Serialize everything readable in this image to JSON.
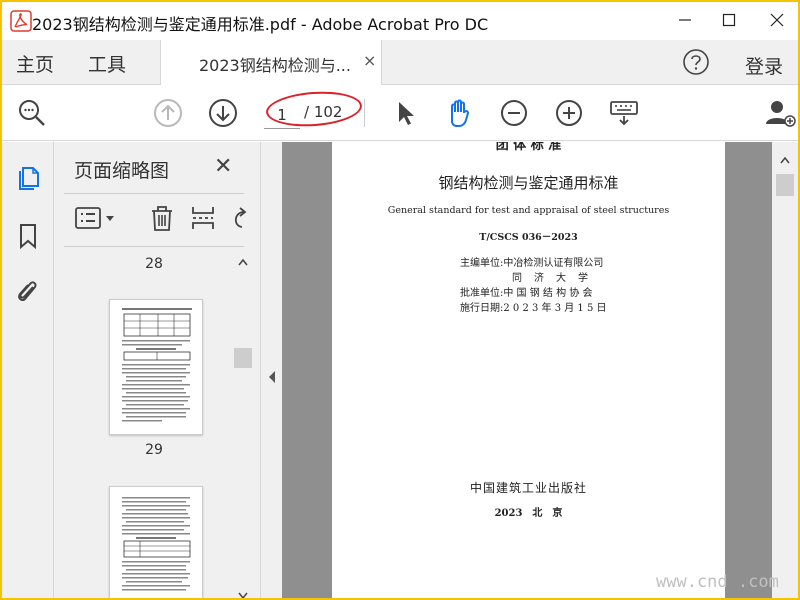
{
  "window": {
    "title": "2023钢结构检测与鉴定通用标准.pdf - Adobe Acrobat Pro DC"
  },
  "tabs": {
    "home": "主页",
    "tools": "工具",
    "document": "2023钢结构检测与...",
    "close": "×"
  },
  "header": {
    "login": "登录"
  },
  "toolbar": {
    "page_current": "1",
    "page_total": "/ 102"
  },
  "thumbnail_panel": {
    "title": "页面缩略图",
    "close": "✕",
    "pages": [
      "28",
      "29"
    ]
  },
  "document": {
    "top_cut": "团 体 标 准",
    "title_cn": "钢结构检测与鉴定通用标准",
    "title_en": "General standard for test and appraisal of steel structures",
    "code": "T/CSCS 036－2023",
    "rows": [
      {
        "label": "主编单位:",
        "value": "中冶检测认证有限公司"
      },
      {
        "label": "",
        "value": "同　济　大　学"
      },
      {
        "label": "批准单位:",
        "value": "中 国 钢 结 构 协 会"
      },
      {
        "label": "施行日期:",
        "value": "2 0 2 3 年 3 月 1 5 日"
      }
    ],
    "publisher": "中国建筑工业出版社",
    "city": "2023　北　京"
  },
  "watermark": "www.cnd  .com",
  "colors": {
    "accent_blue": "#1473e6",
    "highlight_red": "#d9232a",
    "frame_yellow": "#f5c400"
  },
  "icons": [
    "acrobat-icon",
    "minimize-icon",
    "maximize-icon",
    "close-icon",
    "help-icon",
    "find-zoom-icon",
    "page-up-icon",
    "page-down-icon",
    "select-arrow-icon",
    "hand-tool-icon",
    "zoom-out-icon",
    "zoom-in-icon",
    "keyboard-icon",
    "share-user-icon",
    "page-thumbnails-icon",
    "bookmark-icon",
    "attachment-icon",
    "options-menu-icon",
    "delete-icon",
    "insert-page-icon",
    "rotate-icon"
  ]
}
